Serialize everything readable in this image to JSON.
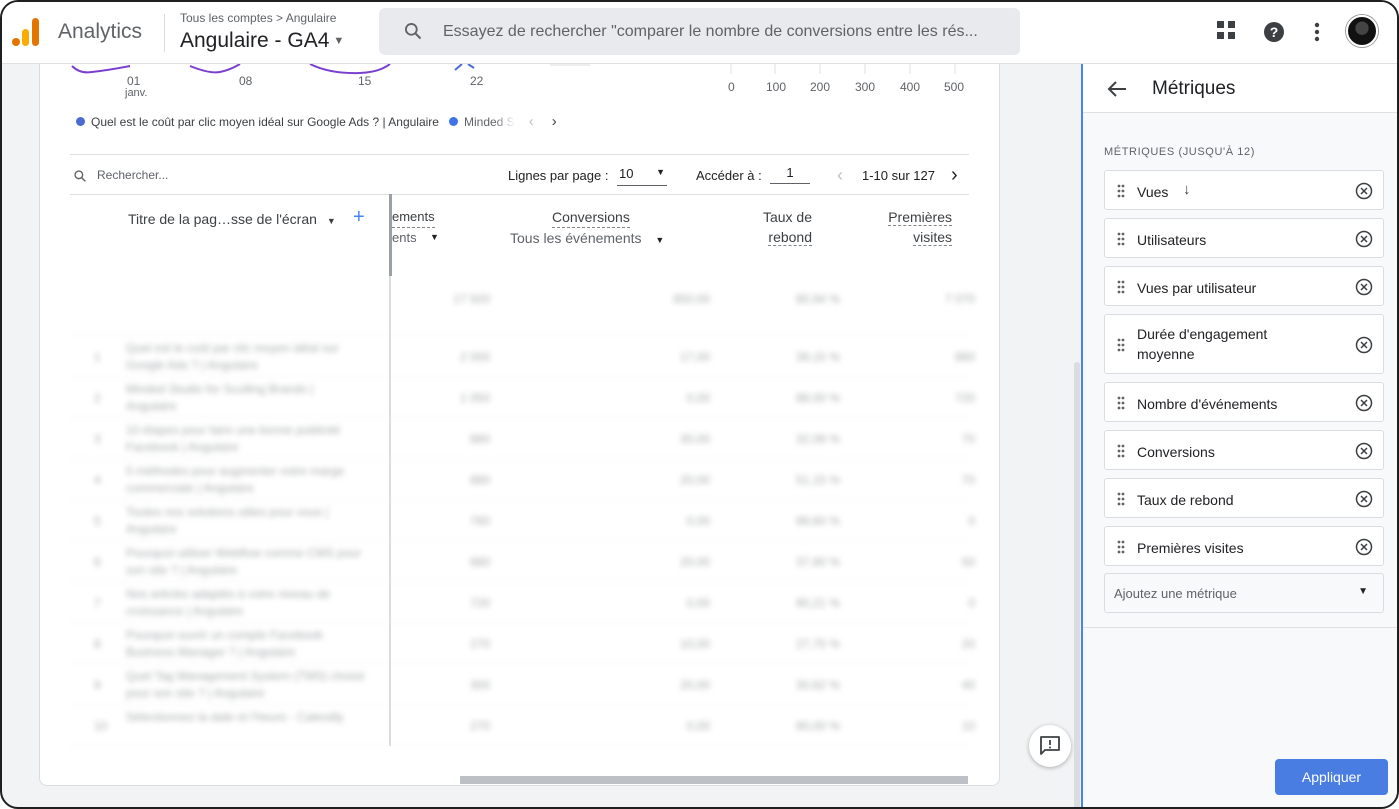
{
  "header": {
    "app_name": "Analytics",
    "breadcrumb": "Tous les comptes > Angulaire",
    "property": "Angulaire - GA4",
    "search_placeholder": "Essayez de rechercher \"comparer le nombre de conversions entre les rés..."
  },
  "chart": {
    "x_ticks": [
      "01",
      "08",
      "15",
      "22"
    ],
    "x_month": "janv.",
    "bar_ticks": [
      "0",
      "100",
      "200",
      "300",
      "400",
      "500"
    ],
    "legend": [
      {
        "label": "Quel est le coût par clic moyen idéal sur Google Ads ? | Angulaire",
        "color": "#4a6bd0"
      },
      {
        "label": "Minded S",
        "color": "#3f73e6"
      }
    ]
  },
  "table_toolbar": {
    "search_placeholder": "Rechercher...",
    "rows_per_page_label": "Lignes par page :",
    "rows_per_page_value": "10",
    "goto_label": "Accéder à :",
    "goto_value": "1",
    "range": "1-10 sur 127"
  },
  "table_header": {
    "dimension": "Titre de la pag…sse de l'écran",
    "events_partial_1": "ements",
    "events_partial_2": "ents",
    "conversions": "Conversions",
    "conversions_filter": "Tous les événements",
    "bounce_1": "Taux de",
    "bounce_2": "rebond",
    "first_visits_1": "Premières",
    "first_visits_2": "visites"
  },
  "blurred_rows": [
    {
      "n": "1",
      "title": "Quel est le coût par clic moyen idéal sur Google Ads ? | Angulaire",
      "c1": "2 000",
      "c2": "17,00",
      "c3": "39,15 %",
      "c4": "880"
    },
    {
      "n": "2",
      "title": "Minded Studio for Sculling Brands | Angulaire",
      "c1": "1 050",
      "c2": "0,00",
      "c3": "88,00 %",
      "c4": "720"
    },
    {
      "n": "3",
      "title": "10 étapes pour faire une bonne publicité Facebook | Angulaire",
      "c1": "880",
      "c2": "30,00",
      "c3": "32,09 %",
      "c4": "70"
    },
    {
      "n": "4",
      "title": "5 méthodes pour augmenter votre marge commerciale | Angulaire",
      "c1": "880",
      "c2": "20,00",
      "c3": "51,15 %",
      "c4": "70"
    },
    {
      "n": "5",
      "title": "Toutes nos solutions utiles pour vous | Angulaire",
      "c1": "760",
      "c2": "0,00",
      "c3": "99,60 %",
      "c4": "0"
    },
    {
      "n": "6",
      "title": "Pourquoi utiliser Webflow comme CMS pour son site ? | Angulaire",
      "c1": "680",
      "c2": "20,00",
      "c3": "37,90 %",
      "c4": "50"
    },
    {
      "n": "7",
      "title": "Nos articles adaptés à votre niveau de croissance | Angulaire",
      "c1": "720",
      "c2": "0,00",
      "c3": "90,21 %",
      "c4": "0"
    },
    {
      "n": "8",
      "title": "Pourquoi ouvrir un compte Facebook Business Manager ? | Angulaire",
      "c1": "270",
      "c2": "10,00",
      "c3": "27,75 %",
      "c4": "20"
    },
    {
      "n": "9",
      "title": "Quel Tag Management System (TMS) choisir pour son site ? | Angulaire",
      "c1": "300",
      "c2": "20,00",
      "c3": "30,62 %",
      "c4": "40"
    },
    {
      "n": "10",
      "title": "Sélectionnez la date et l'heure - Calendly",
      "c1": "270",
      "c2": "0,00",
      "c3": "90,00 %",
      "c4": "10"
    }
  ],
  "totals": {
    "c1": "17 920",
    "c2": "850,00",
    "c3": "80,94 %",
    "c4": "7 070"
  },
  "panel": {
    "title": "Métriques",
    "section_label": "MÉTRIQUES (JUSQU'À 12)",
    "metrics": [
      {
        "label": "Vues",
        "sorted": true
      },
      {
        "label": "Utilisateurs"
      },
      {
        "label": "Vues par utilisateur"
      },
      {
        "label": "Durée d'engagement moyenne"
      },
      {
        "label": "Nombre d'événements"
      },
      {
        "label": "Conversions"
      },
      {
        "label": "Taux de rebond"
      },
      {
        "label": "Premières visites"
      }
    ],
    "add_placeholder": "Ajoutez une métrique",
    "apply_label": "Appliquer"
  }
}
